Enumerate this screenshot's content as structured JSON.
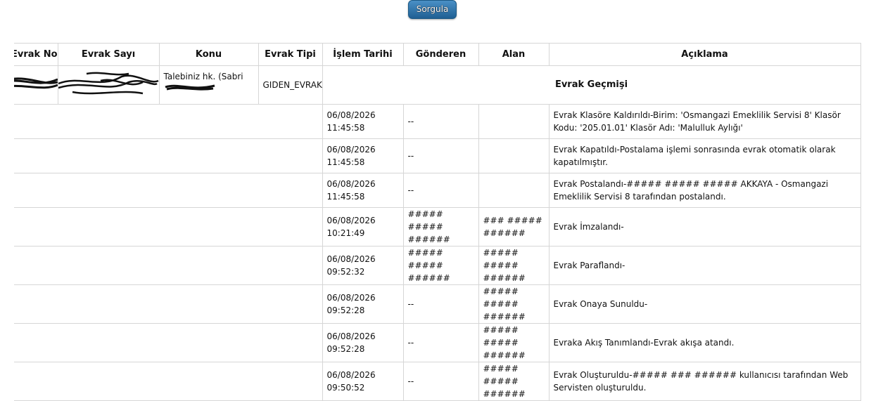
{
  "query_button": {
    "label": "Sorgula"
  },
  "table": {
    "headers": [
      "Evrak No",
      "Evrak Sayı",
      "Konu",
      "Evrak Tipi",
      "İşlem Tarihi",
      "Gönderen",
      "Alan",
      "Açıklama"
    ],
    "document": {
      "evrak_no": "",
      "evrak_sayi": "",
      "konu": "Talebiniz hk. (Sabri",
      "evrak_tipi": "GIDEN_EVRAK",
      "history_title": "Evrak Geçmişi"
    },
    "history": [
      {
        "date": "06/08/2026",
        "time": "11:45:58",
        "gonderen": "--",
        "alan": "",
        "aciklama": "Evrak Klasöre Kaldırıldı-Birim: 'Osmangazi Emeklilik Servisi 8' Klasör Kodu: '205.01.01' Klasör Adı: 'Malulluk Aylığı'"
      },
      {
        "date": "06/08/2026",
        "time": "11:45:58",
        "gonderen": "--",
        "alan": "",
        "aciklama": "Evrak Kapatıldı-Postalama işlemi sonrasında evrak otomatik olarak kapatılmıştır."
      },
      {
        "date": "06/08/2026",
        "time": "11:45:58",
        "gonderen": "--",
        "alan": "",
        "aciklama": "Evrak Postalandı-##### ##### ##### AKKAYA - Osmangazi Emeklilik Servisi 8 tarafından postalandı."
      },
      {
        "date": "06/08/2026",
        "time": "10:21:49",
        "gonderen": "##### ##### ######",
        "alan": "### ##### ######",
        "aciklama": "Evrak İmzalandı-"
      },
      {
        "date": "06/08/2026",
        "time": "09:52:32",
        "gonderen": "##### ##### ######",
        "alan": "##### ##### ######",
        "aciklama": "Evrak Paraflandı-"
      },
      {
        "date": "06/08/2026",
        "time": "09:52:28",
        "gonderen": "--",
        "alan": "##### ##### ######",
        "aciklama": "Evrak Onaya Sunuldu-"
      },
      {
        "date": "06/08/2026",
        "time": "09:52:28",
        "gonderen": "--",
        "alan": "##### ##### ######",
        "aciklama": "Evraka Akış Tanımlandı-Evrak akışa atandı."
      },
      {
        "date": "06/08/2026",
        "time": "09:50:52",
        "gonderen": "--",
        "alan": "##### ##### ######",
        "aciklama": "Evrak Oluşturuldu-##### ### ###### kullanıcısı tarafından Web Servisten oluşturuldu."
      }
    ]
  }
}
